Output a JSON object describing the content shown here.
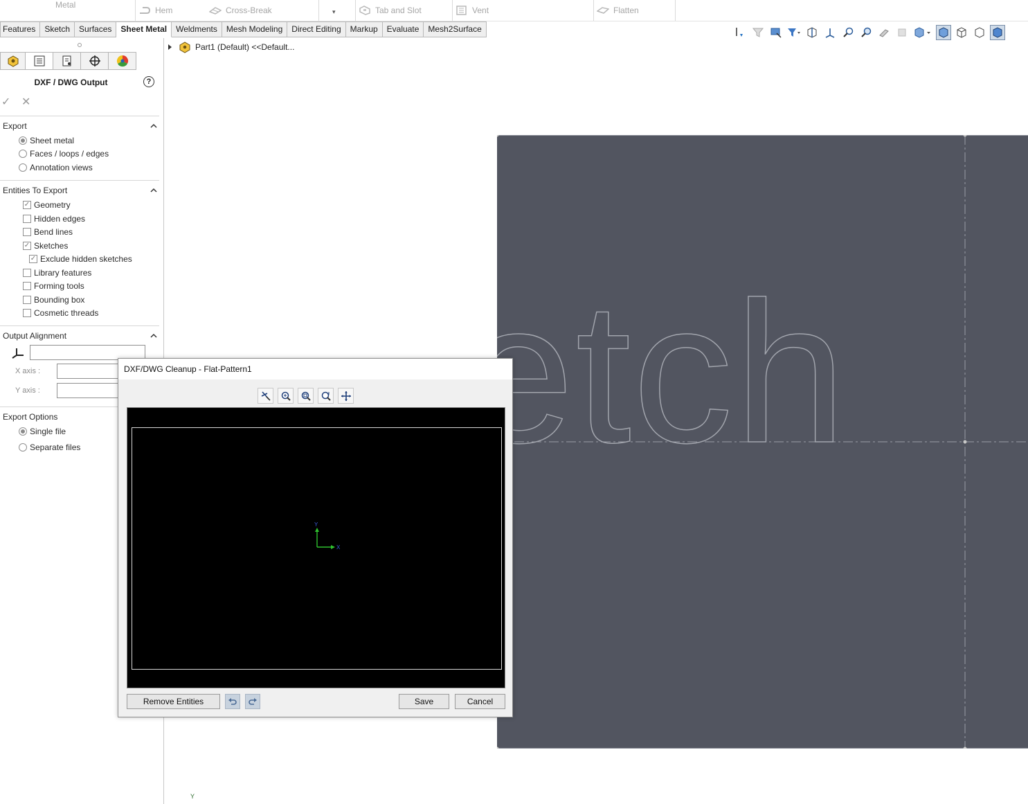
{
  "command_strip": {
    "metal_label": "Metal",
    "hem_label": "Hem",
    "cross_break_label": "Cross-Break",
    "tab_slot_label": "Tab and Slot",
    "vent_label": "Vent",
    "flatten_label": "Flatten"
  },
  "tabs": [
    {
      "label": "Features"
    },
    {
      "label": "Sketch"
    },
    {
      "label": "Surfaces"
    },
    {
      "label": "Sheet Metal",
      "active": true
    },
    {
      "label": "Weldments"
    },
    {
      "label": "Mesh Modeling"
    },
    {
      "label": "Direct Editing"
    },
    {
      "label": "Markup"
    },
    {
      "label": "Evaluate"
    },
    {
      "label": "Mesh2Surface"
    }
  ],
  "property_manager": {
    "title": "DXF / DWG Output",
    "help_glyph": "?",
    "ok_glyph": "✓",
    "cancel_glyph": "✕",
    "export": {
      "heading": "Export",
      "options": [
        "Sheet metal",
        "Faces / loops / edges",
        "Annotation views"
      ],
      "selected": "Sheet metal"
    },
    "entities": {
      "heading": "Entities To Export",
      "items": [
        {
          "label": "Geometry",
          "checked": true
        },
        {
          "label": "Hidden edges",
          "checked": false
        },
        {
          "label": "Bend lines",
          "checked": false
        },
        {
          "label": "Sketches",
          "checked": true
        },
        {
          "label": "Exclude hidden sketches",
          "checked": true
        },
        {
          "label": "Library features",
          "checked": false
        },
        {
          "label": "Forming tools",
          "checked": false
        },
        {
          "label": "Bounding box",
          "checked": false
        },
        {
          "label": "Cosmetic threads",
          "checked": false
        }
      ]
    },
    "alignment": {
      "heading": "Output Alignment",
      "origin_value": "",
      "x_axis_label": "X axis :",
      "x_axis_value": "",
      "y_axis_label": "Y axis :",
      "y_axis_value": ""
    },
    "export_options": {
      "heading": "Export Options",
      "options": [
        "Single file",
        "Separate files"
      ],
      "selected": "Single file"
    }
  },
  "tree": {
    "root_label": "Part1 (Default) <<Default..."
  },
  "graphics": {
    "sketch_text": "etch",
    "axis_y_label": "Y",
    "plate_color": "#525560"
  },
  "dialog": {
    "title": "DXF/DWG Cleanup - Flat-Pattern1",
    "remove_entities_label": "Remove Entities",
    "save_label": "Save",
    "cancel_label": "Cancel",
    "triad_x": "X",
    "triad_y": "Y"
  },
  "colors": {
    "active_tab_bg": "#ffffff",
    "inactive_tab_bg": "#efefef",
    "dialog_bg": "#f0f0f0",
    "preview_bg": "#000000"
  }
}
